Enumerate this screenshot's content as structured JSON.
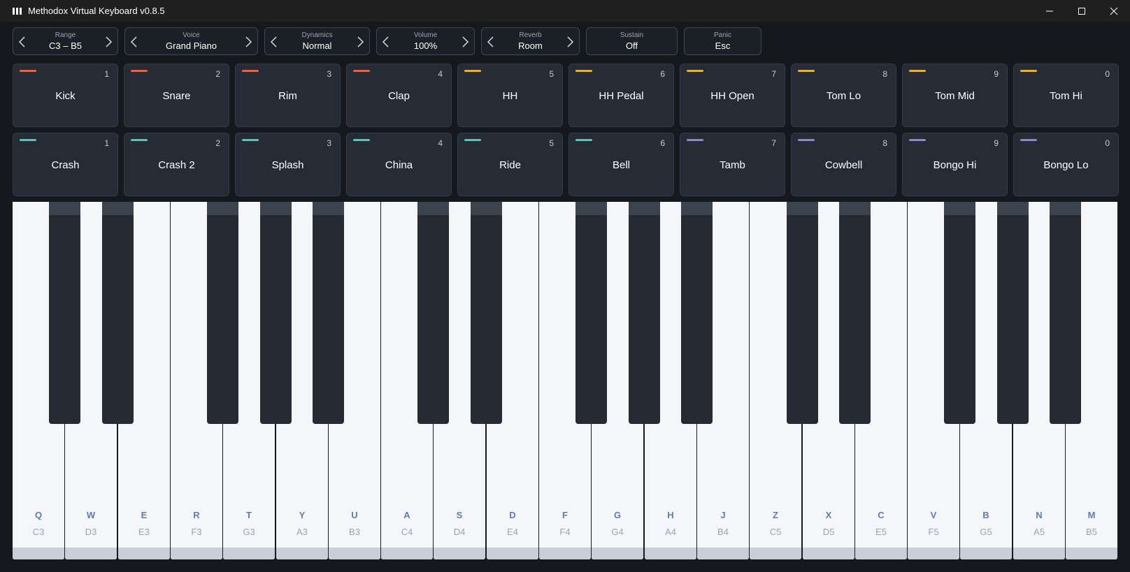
{
  "window": {
    "title": "Methodox Virtual Keyboard v0.8.5",
    "minimize": "—",
    "maximize": "☐",
    "close": "✕"
  },
  "controls": [
    {
      "label": "Range",
      "value": "C3 – B5",
      "arrows": true
    },
    {
      "label": "Voice",
      "value": "Grand Piano",
      "arrows": true
    },
    {
      "label": "Dynamics",
      "value": "Normal",
      "arrows": true
    },
    {
      "label": "Volume",
      "value": "100%",
      "arrows": true
    },
    {
      "label": "Reverb",
      "value": "Room",
      "arrows": true
    },
    {
      "label": "Sustain",
      "value": "Off",
      "arrows": false
    },
    {
      "label": "Panic",
      "value": "Esc",
      "arrows": false
    }
  ],
  "colors": {
    "red": "#e0664b",
    "yellow": "#e3b13c",
    "teal": "#3fd0c4",
    "purple": "#9b7fe0"
  },
  "pads_row1": [
    {
      "name": "Kick",
      "key": "1",
      "color": "#e0664b"
    },
    {
      "name": "Snare",
      "key": "2",
      "color": "#e0664b"
    },
    {
      "name": "Rim",
      "key": "3",
      "color": "#e0664b"
    },
    {
      "name": "Clap",
      "key": "4",
      "color": "#e0664b"
    },
    {
      "name": "HH",
      "key": "5",
      "color": "#e3b13c"
    },
    {
      "name": "HH Pedal",
      "key": "6",
      "color": "#e3b13c"
    },
    {
      "name": "HH Open",
      "key": "7",
      "color": "#e3b13c"
    },
    {
      "name": "Tom Lo",
      "key": "8",
      "color": "#e3b13c"
    },
    {
      "name": "Tom Mid",
      "key": "9",
      "color": "#e3b13c"
    },
    {
      "name": "Tom Hi",
      "key": "0",
      "color": "#e3b13c"
    }
  ],
  "pads_row2": [
    {
      "name": "Crash",
      "key": "1",
      "color": "#3fd0c4"
    },
    {
      "name": "Crash 2",
      "key": "2",
      "color": "#3fd0c4"
    },
    {
      "name": "Splash",
      "key": "3",
      "color": "#3fd0c4"
    },
    {
      "name": "China",
      "key": "4",
      "color": "#3fd0c4"
    },
    {
      "name": "Ride",
      "key": "5",
      "color": "#3fd0c4"
    },
    {
      "name": "Bell",
      "key": "6",
      "color": "#3fd0c4"
    },
    {
      "name": "Tamb",
      "key": "7",
      "color": "#9b7fe0"
    },
    {
      "name": "Cowbell",
      "key": "8",
      "color": "#9b7fe0"
    },
    {
      "name": "Bongo Hi",
      "key": "9",
      "color": "#9b7fe0"
    },
    {
      "name": "Bongo Lo",
      "key": "0",
      "color": "#9b7fe0"
    }
  ],
  "white_keys": [
    {
      "key": "Q",
      "note": "C3"
    },
    {
      "key": "W",
      "note": "D3"
    },
    {
      "key": "E",
      "note": "E3"
    },
    {
      "key": "R",
      "note": "F3"
    },
    {
      "key": "T",
      "note": "G3"
    },
    {
      "key": "Y",
      "note": "A3"
    },
    {
      "key": "U",
      "note": "B3"
    },
    {
      "key": "A",
      "note": "C4"
    },
    {
      "key": "S",
      "note": "D4"
    },
    {
      "key": "D",
      "note": "E4"
    },
    {
      "key": "F",
      "note": "F4"
    },
    {
      "key": "G",
      "note": "G4"
    },
    {
      "key": "H",
      "note": "A4"
    },
    {
      "key": "J",
      "note": "B4"
    },
    {
      "key": "Z",
      "note": "C5"
    },
    {
      "key": "X",
      "note": "D5"
    },
    {
      "key": "C",
      "note": "E5"
    },
    {
      "key": "V",
      "note": "F5"
    },
    {
      "key": "B",
      "note": "G5"
    },
    {
      "key": "N",
      "note": "A5"
    },
    {
      "key": "M",
      "note": "B5"
    }
  ],
  "black_keys": [
    "C#3",
    "D#3",
    "F#3",
    "G#3",
    "A#3",
    "C#4",
    "D#4",
    "F#4",
    "G#4",
    "A#4",
    "C#5",
    "D#5",
    "F#5",
    "G#5",
    "A#5"
  ]
}
